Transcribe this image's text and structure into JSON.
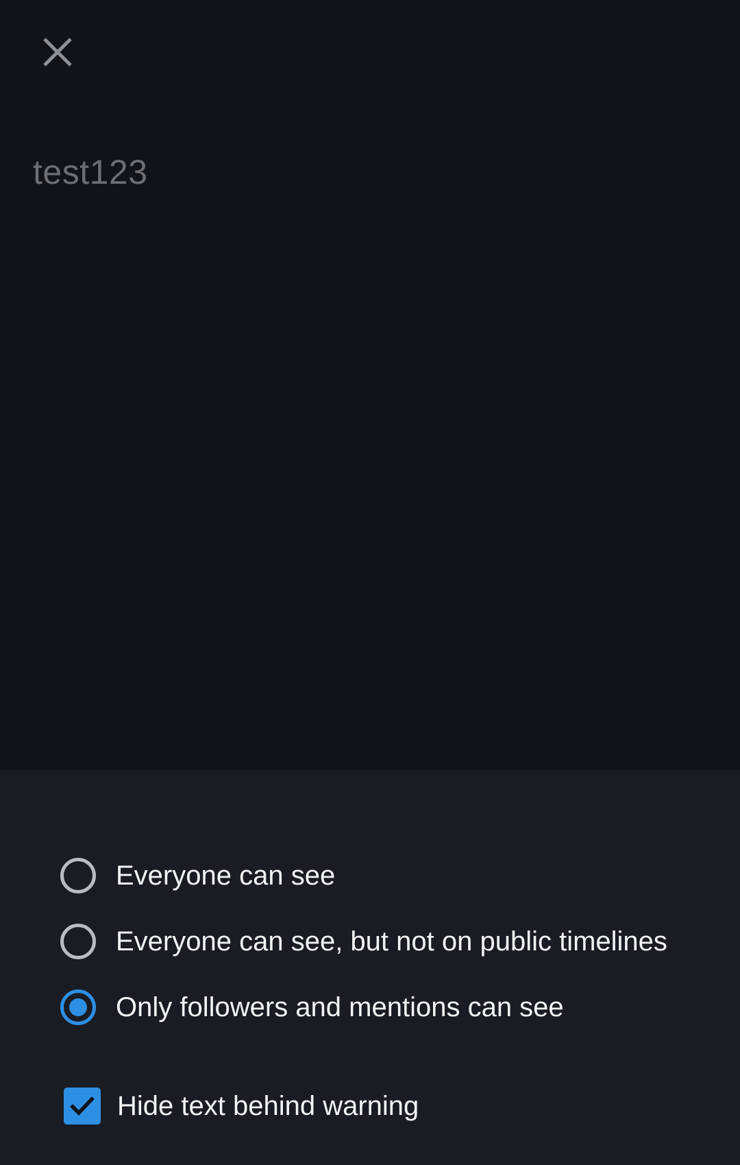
{
  "header": {
    "close_icon": "close-icon"
  },
  "composer": {
    "draft_text": "test123"
  },
  "visibility": {
    "options": [
      {
        "label": "Everyone can see",
        "selected": false
      },
      {
        "label": "Everyone can see, but not on public timelines",
        "selected": false
      },
      {
        "label": "Only followers and mentions can see",
        "selected": true
      }
    ]
  },
  "warning": {
    "label": "Hide text behind warning",
    "checked": true
  },
  "colors": {
    "background": "#121318",
    "panel": "#1a1c24",
    "accent": "#2d8fe4",
    "text": "#f2f3f5",
    "muted_text": "#6c6e74"
  }
}
